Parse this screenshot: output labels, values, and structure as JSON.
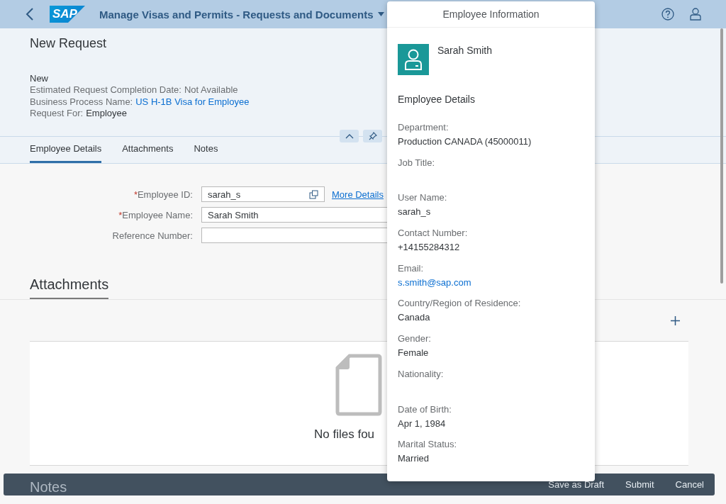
{
  "shell": {
    "logo": "SAP",
    "title": "Manage Visas and Permits - Requests and Documents"
  },
  "header": {
    "title": "New Request",
    "status": "New",
    "lines": [
      {
        "label": "Estimated Request Completion Date:",
        "value": "Not Available",
        "kind": "plain"
      },
      {
        "label": "Business Process Name:",
        "value": "US H-1B Visa for Employee",
        "kind": "link"
      },
      {
        "label": "Request For:",
        "value": "Employee",
        "kind": "emphasis"
      }
    ]
  },
  "tabs": [
    {
      "label": "Employee Details",
      "selected": true
    },
    {
      "label": "Attachments",
      "selected": false
    },
    {
      "label": "Notes",
      "selected": false
    }
  ],
  "form": {
    "fields": [
      {
        "mark": "*",
        "label": "Employee ID:",
        "value": "sarah_s",
        "kind": "value_help",
        "link": "More Details"
      },
      {
        "mark": "*",
        "label": "Employee Name:",
        "value": "Sarah Smith",
        "kind": "text"
      },
      {
        "label": "Reference Number:",
        "kind": "text"
      }
    ]
  },
  "attachments": {
    "title": "Attachments",
    "empty_text": "No files fou"
  },
  "notes": {
    "title": "Notes"
  },
  "footer": {
    "buttons": [
      "Save as Draft",
      "Submit",
      "Cancel"
    ]
  },
  "popover": {
    "title": "Employee Information",
    "name": "Sarah Smith",
    "section": "Employee Details",
    "fields": [
      {
        "label": "Department:",
        "value": "Production CANADA (45000011)",
        "kind": "text"
      },
      {
        "label": "Job Title:"
      },
      {
        "label": "User Name:",
        "value": "sarah_s",
        "kind": "text"
      },
      {
        "label": "Contact Number:",
        "value": "+14155284312",
        "kind": "text"
      },
      {
        "label": "Email:",
        "value": "s.smith@sap.com",
        "kind": "link"
      },
      {
        "label": "Country/Region of Residence:",
        "value": "Canada",
        "kind": "text"
      },
      {
        "label": "Gender:",
        "value": "Female",
        "kind": "text"
      },
      {
        "label": "Nationality:"
      },
      {
        "label": "Date of Birth:",
        "value": "Apr 1, 1984",
        "kind": "text"
      },
      {
        "label": "Marital Status:",
        "value": "Married",
        "kind": "text"
      }
    ]
  }
}
